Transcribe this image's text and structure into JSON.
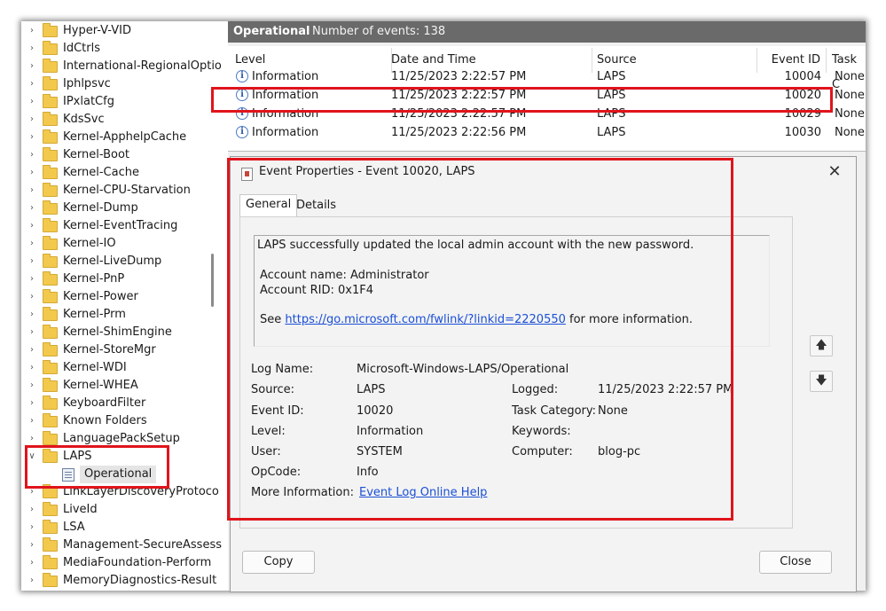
{
  "tree": {
    "items": [
      {
        "label": "Hyper-V-VID",
        "expanded": false
      },
      {
        "label": "IdCtrls",
        "expanded": false
      },
      {
        "label": "International-RegionalOptio",
        "expanded": false
      },
      {
        "label": "Iphlpsvc",
        "expanded": false
      },
      {
        "label": "IPxlatCfg",
        "expanded": false
      },
      {
        "label": "KdsSvc",
        "expanded": false
      },
      {
        "label": "Kernel-ApphelpCache",
        "expanded": false
      },
      {
        "label": "Kernel-Boot",
        "expanded": false
      },
      {
        "label": "Kernel-Cache",
        "expanded": false
      },
      {
        "label": "Kernel-CPU-Starvation",
        "expanded": false
      },
      {
        "label": "Kernel-Dump",
        "expanded": false
      },
      {
        "label": "Kernel-EventTracing",
        "expanded": false
      },
      {
        "label": "Kernel-IO",
        "expanded": false
      },
      {
        "label": "Kernel-LiveDump",
        "expanded": false
      },
      {
        "label": "Kernel-PnP",
        "expanded": false
      },
      {
        "label": "Kernel-Power",
        "expanded": false
      },
      {
        "label": "Kernel-Prm",
        "expanded": false
      },
      {
        "label": "Kernel-ShimEngine",
        "expanded": false
      },
      {
        "label": "Kernel-StoreMgr",
        "expanded": false
      },
      {
        "label": "Kernel-WDI",
        "expanded": false
      },
      {
        "label": "Kernel-WHEA",
        "expanded": false
      },
      {
        "label": "KeyboardFilter",
        "expanded": false
      },
      {
        "label": "Known Folders",
        "expanded": false
      },
      {
        "label": "LanguagePackSetup",
        "expanded": false
      },
      {
        "label": "LAPS",
        "expanded": true
      },
      {
        "label": "Operational",
        "child": true
      },
      {
        "label": "LinkLayerDiscoveryProtoco",
        "expanded": false
      },
      {
        "label": "LiveId",
        "expanded": false
      },
      {
        "label": "LSA",
        "expanded": false
      },
      {
        "label": "Management-SecureAssess",
        "expanded": false
      },
      {
        "label": "MediaFoundation-Perform",
        "expanded": false
      },
      {
        "label": "MemoryDiagnostics-Result",
        "expanded": false
      }
    ]
  },
  "pane": {
    "title": "Operational",
    "count": "Number of events: 138"
  },
  "grid": {
    "columns": [
      "Level",
      "Date and Time",
      "Source",
      "Event ID",
      "Task C"
    ],
    "rows": [
      {
        "level": "Information",
        "datetime": "11/25/2023 2:22:57 PM",
        "source": "LAPS",
        "event_id": "10004",
        "task": "None"
      },
      {
        "level": "Information",
        "datetime": "11/25/2023 2:22:57 PM",
        "source": "LAPS",
        "event_id": "10020",
        "task": "None"
      },
      {
        "level": "Information",
        "datetime": "11/25/2023 2:22:57 PM",
        "source": "LAPS",
        "event_id": "10029",
        "task": "None"
      },
      {
        "level": "Information",
        "datetime": "11/25/2023 2:22:56 PM",
        "source": "LAPS",
        "event_id": "10030",
        "task": "None"
      }
    ]
  },
  "dialog": {
    "title": "Event Properties - Event 10020, LAPS",
    "close_glyph": "✕",
    "tabs": [
      "General",
      "Details"
    ],
    "message": {
      "line1": "LAPS successfully updated the local admin account with the new password.",
      "line2": "Account name: Administrator",
      "line3": "Account RID: 0x1F4",
      "see_prefix": "See ",
      "link": "https://go.microsoft.com/fwlink/?linkid=2220550",
      "see_suffix": " for more information."
    },
    "props": {
      "log_name_label": "Log Name:",
      "log_name": "Microsoft-Windows-LAPS/Operational",
      "source_label": "Source:",
      "source": "LAPS",
      "logged_label": "Logged:",
      "logged": "11/25/2023 2:22:57 PM",
      "event_id_label": "Event ID:",
      "event_id": "10020",
      "task_category_label": "Task Category:",
      "task_category": "None",
      "level_label": "Level:",
      "level": "Information",
      "keywords_label": "Keywords:",
      "keywords": "",
      "user_label": "User:",
      "user": "SYSTEM",
      "computer_label": "Computer:",
      "computer": "blog-pc",
      "opcode_label": "OpCode:",
      "opcode": "Info",
      "more_info_label": "More Information:",
      "more_info_link": "Event Log Online Help"
    },
    "copy_label": "Copy",
    "close_label": "Close"
  },
  "colors": {
    "highlight": "#e0141c",
    "pane_header": "#6a6a6a",
    "link": "#1a4fd6"
  }
}
